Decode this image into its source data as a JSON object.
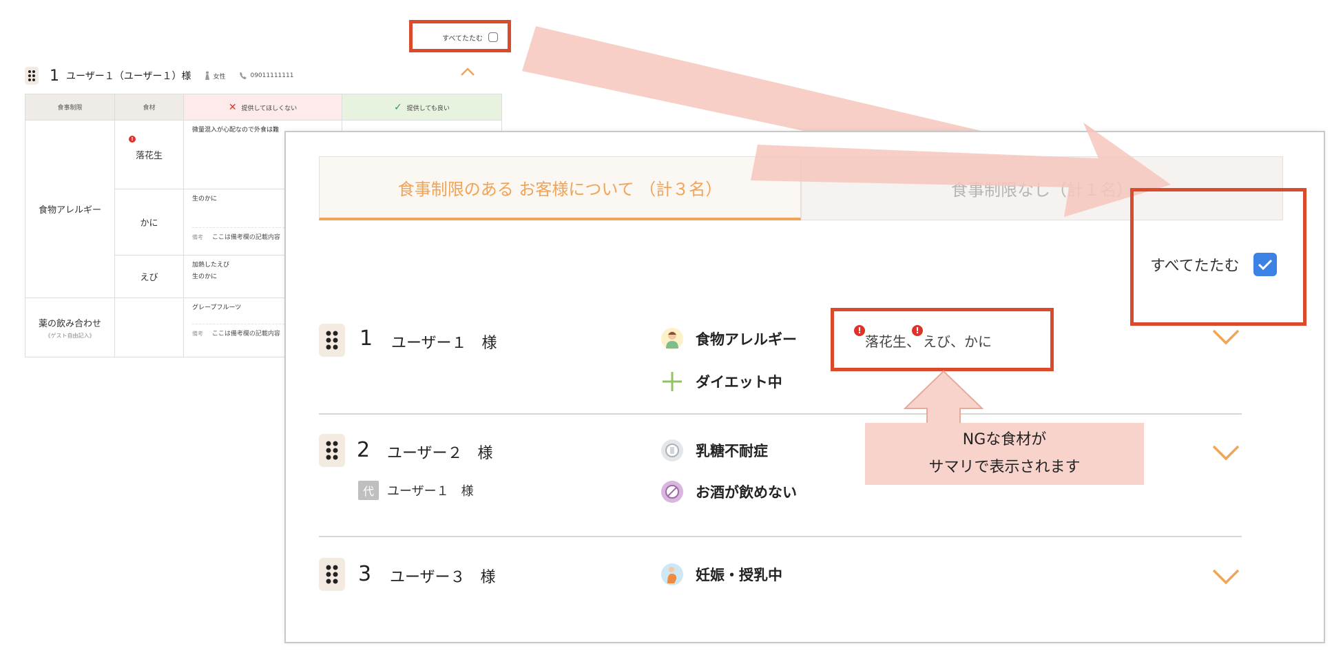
{
  "colors": {
    "accent_orange": "#f1a356",
    "callout_red": "#dc4a2c",
    "arrow_pink": "#f6c7bd",
    "note_bg": "#f8d3cc",
    "checkbox_blue": "#3b82e4",
    "alert_red": "#e0312a"
  },
  "old_screen": {
    "collapse_all_label": "すべてたたむ",
    "user_header": {
      "number": "1",
      "name": "ユーザー１（ユーザー１）様",
      "gender": "女性",
      "phone": "09011111111"
    },
    "table": {
      "headers": {
        "restriction": "食事制限",
        "ingredient": "食材",
        "ng": "提供してほしくない",
        "ok": "提供しても良い"
      },
      "note_label": "備考",
      "note_text": "ここは備考欄の記載内容",
      "allergy_category": "食物アレルギー",
      "items": [
        {
          "food": "落花生",
          "ng_text": "微量混入が心配なので外食は難"
        },
        {
          "food": "かに",
          "ng_text": "生のかに"
        },
        {
          "food": "えび",
          "ng_text_1": "加熱したえび",
          "ng_text_2": "生のかに"
        }
      ],
      "drug_category": "薬の飲み合わせ",
      "drug_sub": "《ゲスト自由記入》",
      "drug_ng_text": "グレープフルーツ"
    }
  },
  "new_screen": {
    "tabs": {
      "active": "食事制限のある お客様について （計３名）",
      "inactive": "食事制限なし（計１名）"
    },
    "collapse_all_label": "すべてたたむ",
    "rows": [
      {
        "number": "1",
        "name": "ユーザー１　様",
        "restrictions": [
          "食物アレルギー",
          "ダイエット中"
        ],
        "ng_summary": {
          "item1": "落花生",
          "sep1": "、",
          "item2": "えび、かに"
        }
      },
      {
        "number": "2",
        "name": "ユーザー２　様",
        "proxy_tag": "代",
        "proxy_name": "ユーザー１　様",
        "restrictions": [
          "乳糖不耐症",
          "お酒が飲めない"
        ]
      },
      {
        "number": "3",
        "name": "ユーザー３　様",
        "restrictions": [
          "妊娠・授乳中"
        ]
      }
    ]
  },
  "annotation": {
    "line1": "NGな食材が",
    "line2": "サマリで表示されます"
  }
}
